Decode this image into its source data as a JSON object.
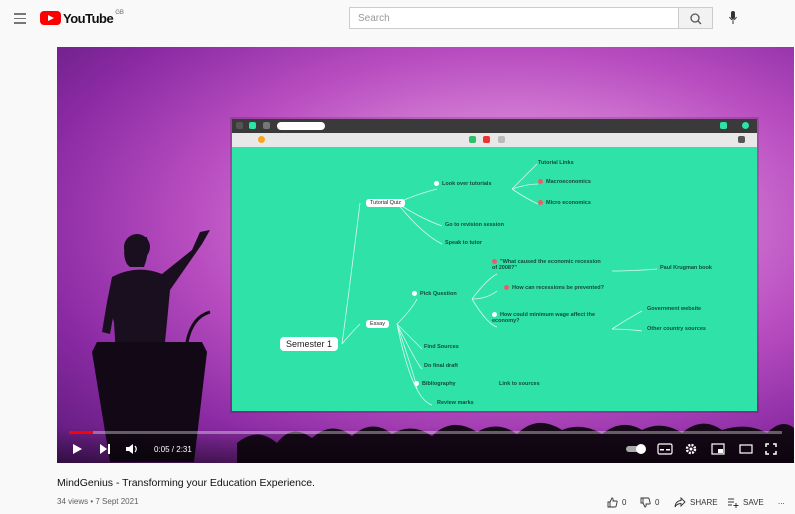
{
  "header": {
    "logo_text": "YouTube",
    "logo_suffix": "GB",
    "search_placeholder": "Search"
  },
  "mindmap": {
    "root": "Semester 1",
    "nodes": {
      "tutorial_quiz": "Tutorial Quiz",
      "look_over_tutorials": "Look over tutorials",
      "tutorial_links": "Tutorial Links",
      "macroeconomics": "Macroeconomics",
      "micro_economics": "Micro economics",
      "revision_session": "Go to revision session",
      "speak_to_tutor": "Speak to tutor",
      "essay": "Essay",
      "pick_question": "Pick Question",
      "q_recession": "\"What caused the economic recession of 2008?\"",
      "paul_krugman": "Paul Krugman book",
      "q_prevented": "How can recessions be prevented?",
      "q_min_wage": "How could minimum wage affect the economy?",
      "gov_website": "Government website",
      "other_country": "Other country sources",
      "find_sources": "Find Sources",
      "final_draft": "Do final draft",
      "bibliography": "Bibliography",
      "link_sources": "Link to sources",
      "review_marks": "Review marks"
    }
  },
  "player": {
    "time": "0:05 / 2:31",
    "progress": 0.033
  },
  "video": {
    "title": "MindGenius - Transforming your Education Experience.",
    "meta": "34 views • 7 Sept 2021",
    "likes": "0",
    "dislikes": "0",
    "share_label": "SHARE",
    "save_label": "SAVE",
    "more_label": "..."
  }
}
